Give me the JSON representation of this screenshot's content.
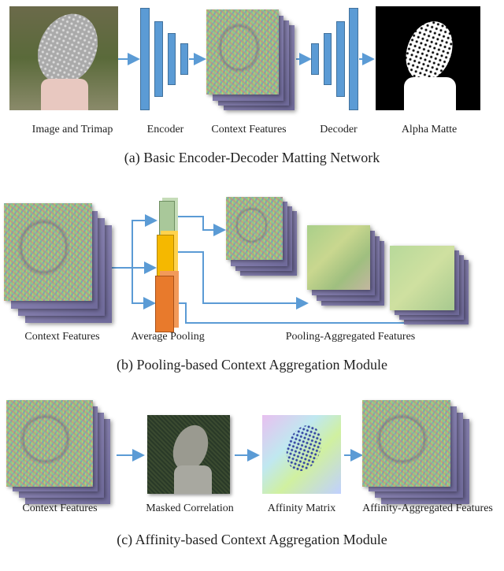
{
  "panel_a": {
    "labels": {
      "image": "Image and Trimap",
      "encoder": "Encoder",
      "context": "Context Features",
      "decoder": "Decoder",
      "alpha": "Alpha Matte"
    },
    "caption": "(a) Basic Encoder-Decoder Matting Network"
  },
  "panel_b": {
    "labels": {
      "context": "Context Features",
      "pooling": "Average Pooling",
      "aggregated": "Pooling-Aggregated Features"
    },
    "caption": "(b) Pooling-based Context Aggregation Module"
  },
  "panel_c": {
    "labels": {
      "context": "Context Features",
      "masked": "Masked Correlation",
      "affinity": "Affinity Matrix",
      "aggregated": "Affinity-Aggregated Features"
    },
    "caption": "(c) Affinity-based Context Aggregation Module"
  },
  "colors": {
    "arrow": "#5b9bd5",
    "encoder": "#5b9bd5",
    "pool_green": "#a9c89a",
    "pool_yellow": "#f5b800",
    "pool_orange": "#e87a2c"
  }
}
